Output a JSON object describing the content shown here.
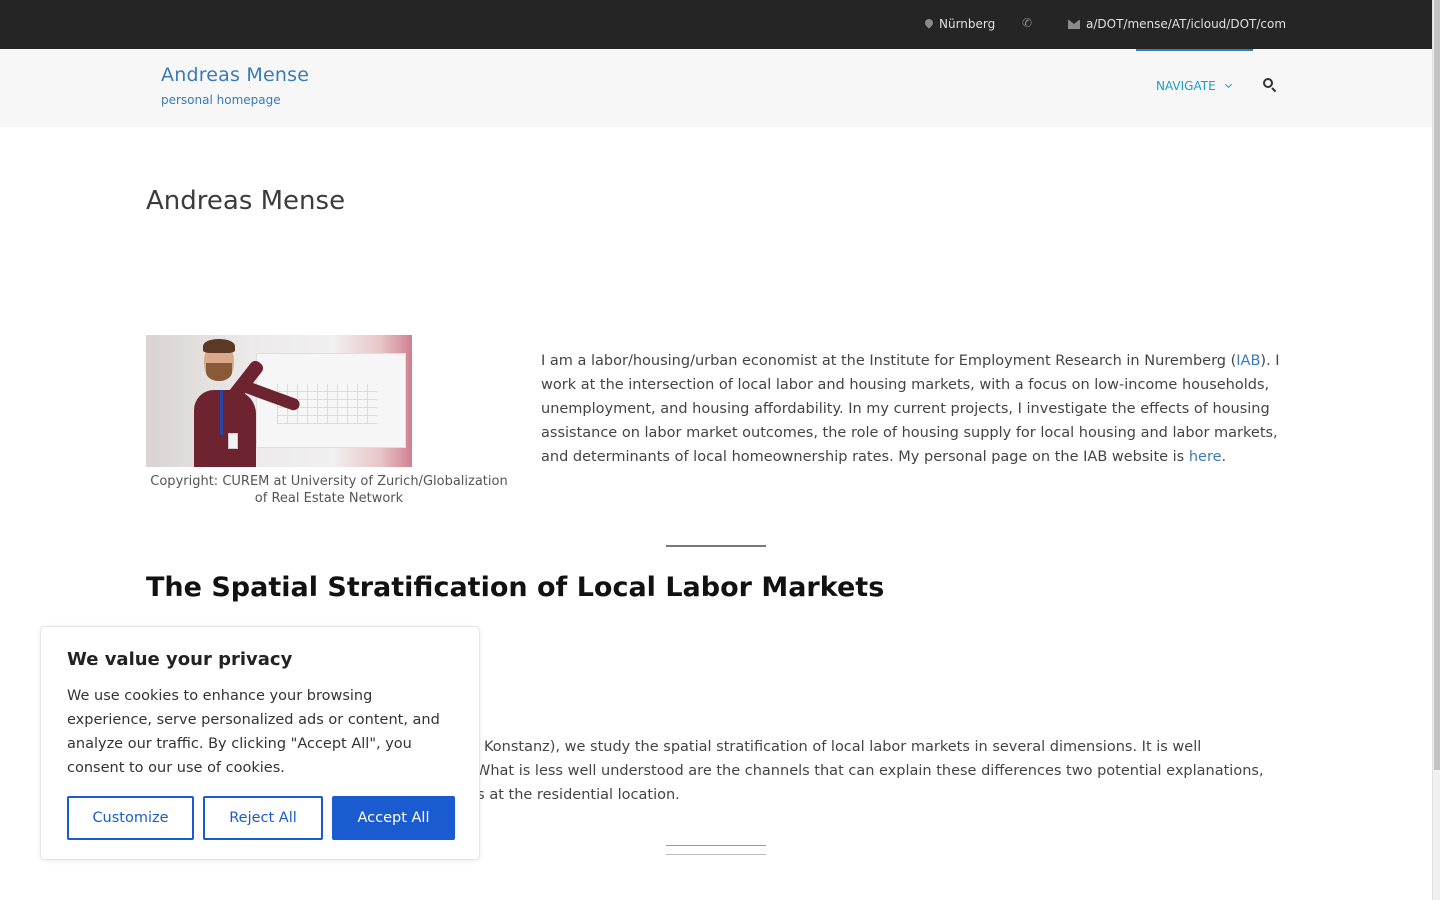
{
  "topbar": {
    "location": "Nürnberg",
    "email": "a/DOT/mense/AT/icloud/DOT/com"
  },
  "header": {
    "site_title": "Andreas Mense",
    "site_description": "personal homepage",
    "nav_label": "NAVIGATE"
  },
  "page": {
    "title": "Andreas Mense",
    "image_caption": "Copyright: CUREM at University of Zurich/Globalization of Real Estate Network",
    "intro": {
      "text_before_iab": "I am a labor/housing/urban economist at the Institute for Employment Research in Nuremberg (",
      "iab_link": "IAB",
      "text_after_iab": "). I work at the intersection of local labor and housing markets, with a focus on low-income households, unemployment, and housing affordability. In my current projects, I investigate the effects of housing assistance on labor market outcomes, the role of housing supply for local housing and labor markets, and determinants of local homeownership rates. My personal page on the IAB website is ",
      "here_link": "here",
      "text_end": "."
    },
    "section": {
      "title": "The Spatial Stratification of Local Labor Markets",
      "text": "Konstanz), we study the spatial stratification of local labor markets in several dimensions. It is well understood nomic opportunities than others. What is less well understood are the channels that can explain these differences two potential explanations, the quality of firms in a location, and networks at the residential location."
    }
  },
  "cookie_banner": {
    "title": "We value your privacy",
    "text": "We use cookies to enhance your browsing experience, serve personalized ads or content, and analyze our traffic. By clicking \"Accept All\", you consent to our use of cookies.",
    "customize_label": "Customize",
    "reject_label": "Reject All",
    "accept_label": "Accept All",
    "accent_color": "#1a5ccf"
  },
  "colors": {
    "topbar_bg": "#252525",
    "link": "#3a7ab5",
    "nav": "#1aa0c4"
  }
}
